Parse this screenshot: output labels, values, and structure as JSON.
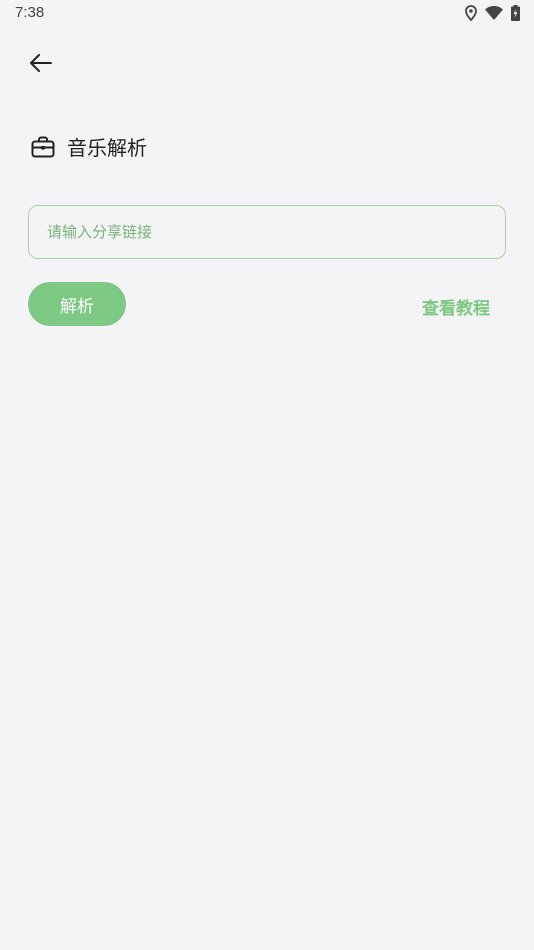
{
  "status_bar": {
    "time": "7:38",
    "icons": [
      "location-icon",
      "wifi-icon",
      "battery-icon"
    ]
  },
  "header": {
    "back_icon": "back-arrow-icon",
    "title": "音乐解析",
    "title_icon": "briefcase-icon"
  },
  "form": {
    "input_placeholder": "请输入分享链接",
    "input_value": "",
    "parse_label": "解析",
    "tutorial_label": "查看教程"
  },
  "colors": {
    "background": "#f4f4f7",
    "accent": "#7dc883",
    "input_border": "#a7cfa9",
    "placeholder": "#7ab17e"
  }
}
